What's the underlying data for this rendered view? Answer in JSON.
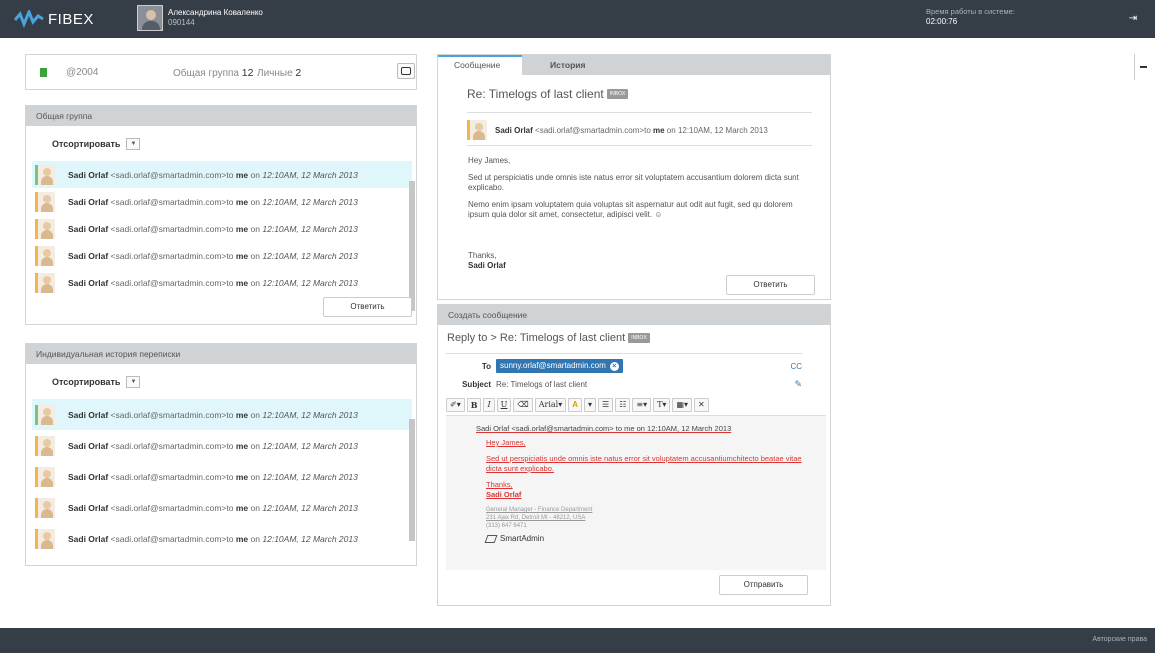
{
  "header": {
    "brand": "FIBEX",
    "user_name": "Александрина Коваленко",
    "user_id": "090144",
    "worktime_label": "Время работы в системе:",
    "worktime_value": "02:00:76"
  },
  "stats": {
    "code": "@2004",
    "group_label": "Общая группа",
    "group_count": "12",
    "personal_label": "Личные",
    "personal_count": "2"
  },
  "group_panel": {
    "title": "Общая группа",
    "sort_label": "Отсортировать",
    "reply_label": "Ответить"
  },
  "history_panel": {
    "title": "Индивидуальная история переписки",
    "sort_label": "Отсортировать"
  },
  "message_row": {
    "sender": "Sadi Orlaf",
    "email": "<sadi.orlaf@smartadmin.com>",
    "to_word": "to",
    "me": "me",
    "on": "on",
    "date": "12:10AM, 12 March 2013"
  },
  "message": {
    "tab_message": "Сообщение",
    "tab_history": "История",
    "subject": "Re: Timelogs of last client",
    "badge": "INBOX",
    "greeting": "Hey James,",
    "para1": "Sed ut perspiciatis unde omnis iste natus error sit voluptatem accusantium dolorem dicta sunt explicabo.",
    "para2": "Nemo enim ipsam voluptatem quia voluptas sit aspernatur aut odit aut fugit, sed qu dolorem ipsum quia dolor sit amet, consectetur, adipisci velit. ☺",
    "thanks": "Thanks,",
    "signature": "Sadi Orlaf",
    "reply_label": "Ответить"
  },
  "compose": {
    "title": "Создать сообщение",
    "reply_to": "Reply to > Re: Timelogs of last client",
    "badge": "INBOX",
    "to_label": "To",
    "to_value": "sunny.orlaf@smartadmin.com",
    "cc_label": "CC",
    "subject_label": "Subject",
    "subject_value": "Re: Timelogs of last client",
    "font_label": "Arial",
    "quote_header": "Sadi Orlaf <sadi.orlaf@smartadmin.com> to me on 12:10AM, 12 March 2013",
    "quote_greeting": "Hey James,",
    "quote_body": "Sed ut perspiciatis unde omnis iste natus error sit voluptatem accusantiumchitecto beatae vitae dicta sunt explicabo.",
    "quote_thanks": "Thanks,",
    "quote_name": "Sadi Orlaf",
    "quote_title": "General Manager - Finance Department",
    "quote_address": "231 Ajax Rd, Detroit MI - 48212, USA",
    "quote_phone": "(313) 647 6471",
    "quote_logo": "SmartAdmin",
    "send_label": "Отправить"
  },
  "footer": {
    "copyright": "Авторские права"
  },
  "colors": {
    "topbar": "#353d47",
    "panel_header": "#cfd3d6",
    "active_row": "#dff7fb",
    "accent": "#3276b1"
  }
}
